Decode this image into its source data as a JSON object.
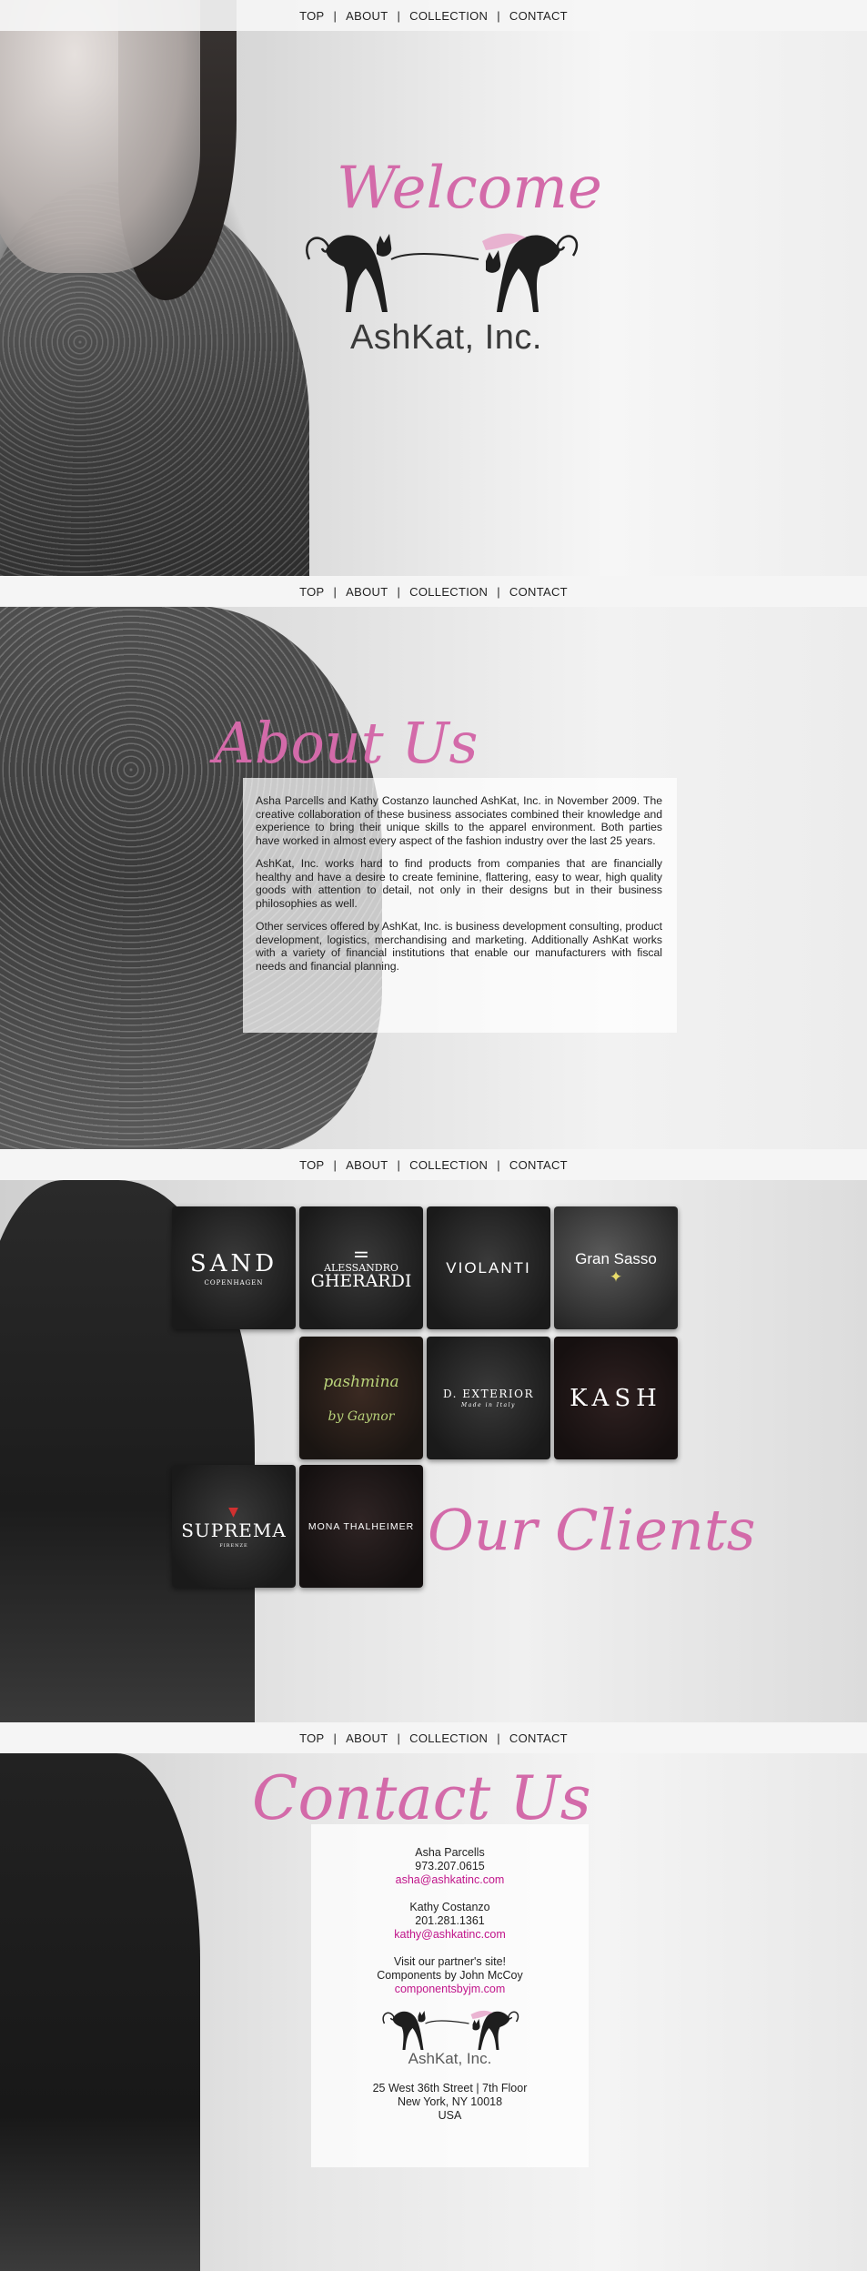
{
  "nav": {
    "top": "TOP",
    "about": "ABOUT",
    "collection": "COLLECTION",
    "contact": "CONTACT",
    "separator": "|"
  },
  "hero": {
    "welcome": "Welcome",
    "brand": "AshKat, Inc."
  },
  "about": {
    "title": "About  Us",
    "paragraphs": [
      "Asha Parcells and Kathy Costanzo launched AshKat, Inc. in November 2009. The creative collaboration of these business associates combined their knowledge and experience to bring their unique skills to the apparel environment. Both parties have worked in almost every aspect of the fashion industry over the last 25 years.",
      "AshKat, Inc. works hard to find products from companies that are financially healthy and have a desire to create feminine, flattering, easy to wear, high quality goods with attention to detail, not only in their designs but in their business philosophies as well.",
      "Other services offered by AshKat, Inc. is business development consulting, product development, logistics, merchandising and marketing. Additionally AshKat works with a variety of financial institutions that enable our manufacturers with fiscal needs and financial planning."
    ]
  },
  "clients": {
    "title": "Our  Clients",
    "brands": {
      "sand": "SAND",
      "sand_sub": "COPENHAGEN",
      "alessandro": "ALESSANDRO",
      "gherardi": "GHERARDI",
      "violanti": "VIOLANTI",
      "gransasso": "Gran Sasso",
      "pashmina": "pashmina",
      "pashmina_by": "by Gaynor",
      "dexterior": "D. EXTERIOR",
      "dexterior_sub": "Made in Italy",
      "kash": "KASH",
      "suprema": "SUPREMA",
      "suprema_sub": "FIRENZE",
      "mona": "MONA THALHEIMER"
    }
  },
  "contact": {
    "title": "Contact  Us",
    "person1": {
      "name": "Asha Parcells",
      "phone": "973.207.0615",
      "email": "asha@ashkatinc.com"
    },
    "person2": {
      "name": "Kathy Costanzo",
      "phone": "201.281.1361",
      "email": "kathy@ashkatinc.com"
    },
    "partner_line1": "Visit our partner's site!",
    "partner_line2": "Components by John McCoy",
    "partner_link": "componentsbyjm.com",
    "brand": "AshKat, Inc.",
    "address1": "25 West 36th Street | 7th Floor",
    "address2": "New York, NY 10018",
    "address3": "USA"
  },
  "colors": {
    "accent_pink": "#d36aa9",
    "link_magenta": "#c0148a"
  }
}
